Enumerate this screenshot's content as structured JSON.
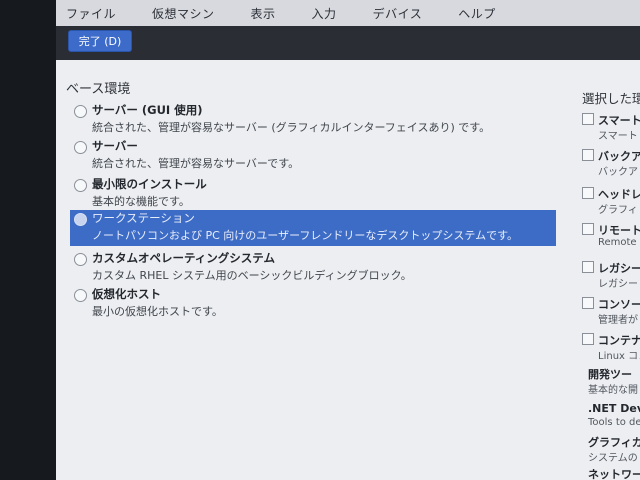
{
  "menubar": {
    "items": [
      "ファイル",
      "仮想マシン",
      "表示",
      "入力",
      "デバイス",
      "ヘルプ"
    ]
  },
  "header": {
    "done_label": "完了 (D)"
  },
  "base_env": {
    "title": "ベース環境",
    "items": [
      {
        "title": "サーバー (GUI 使用)",
        "desc": "統合された、管理が容易なサーバー (グラフィカルインターフェイスあり) です。",
        "selected": false
      },
      {
        "title": "サーバー",
        "desc": "統合された、管理が容易なサーバーです。",
        "selected": false
      },
      {
        "title": "最小限のインストール",
        "desc": "基本的な機能です。",
        "selected": false
      },
      {
        "title": "ワークステーション",
        "desc": "ノートパソコンおよび PC 向けのユーザーフレンドリーなデスクトップシステムです。",
        "selected": true
      },
      {
        "title": "カスタムオペレーティングシステム",
        "desc": "カスタム RHEL システム用のベーシックビルディングブロック。",
        "selected": false
      },
      {
        "title": "仮想化ホスト",
        "desc": "最小の仮想化ホストです。",
        "selected": false
      }
    ]
  },
  "addons": {
    "title": "選択した環",
    "items": [
      {
        "title": "スマート",
        "desc": "スマート",
        "checkbox": true
      },
      {
        "title": "バックア",
        "desc": "バックア",
        "checkbox": true
      },
      {
        "title": "ヘッドレ",
        "desc": "グラフィ",
        "checkbox": true
      },
      {
        "title": "リモート",
        "desc": "Remote d",
        "checkbox": true
      },
      {
        "title": "レガシー",
        "desc": "レガシー",
        "checkbox": true
      },
      {
        "title": "コンソール",
        "desc": "管理者が",
        "checkbox": true
      },
      {
        "title": "コンテナ",
        "desc": "Linux コン",
        "checkbox": true
      },
      {
        "title": "開発ツー",
        "desc": "基本的な開",
        "checkbox": false
      },
      {
        "title": ".NET Deve",
        "desc": "Tools to de",
        "checkbox": false
      },
      {
        "title": "グラフィカ",
        "desc": "システムの",
        "checkbox": false
      },
      {
        "title": "ネットワー",
        "desc": "",
        "checkbox": false
      }
    ]
  }
}
